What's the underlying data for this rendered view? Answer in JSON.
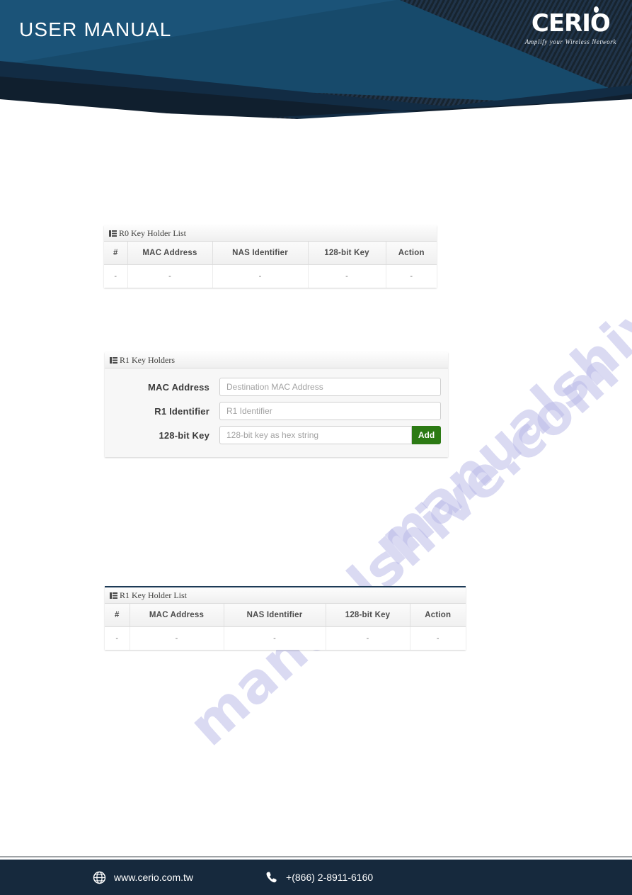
{
  "header": {
    "title": "USER MANUAL",
    "logo": {
      "name": "CERIO",
      "tagline": "Amplify your Wireless Network"
    }
  },
  "watermark": {
    "line1": "manualshive.com",
    "line2": "manualshive.com"
  },
  "panels": {
    "r0_list": {
      "heading": "R0 Key Holder List",
      "icon": "list-icon",
      "columns": [
        "#",
        "MAC Address",
        "NAS Identifier",
        "128-bit Key",
        "Action"
      ],
      "rows": [
        [
          "-",
          "-",
          "-",
          "-",
          "-"
        ]
      ]
    },
    "r1_form": {
      "heading": "R1 Key Holders",
      "icon": "list-icon",
      "fields": [
        {
          "label": "MAC Address",
          "value": "",
          "placeholder": "Destination MAC Address"
        },
        {
          "label": "R1 Identifier",
          "value": "",
          "placeholder": "R1 Identifier"
        },
        {
          "label": "128-bit Key",
          "value": "",
          "placeholder": "128-bit key as hex string"
        }
      ],
      "add_button": "Add",
      "add_button_color": "#2c7a14"
    },
    "r1_list": {
      "heading": "R1 Key Holder List",
      "icon": "list-icon",
      "columns": [
        "#",
        "MAC Address",
        "NAS Identifier",
        "128-bit Key",
        "Action"
      ],
      "rows": [
        [
          "-",
          "-",
          "-",
          "-",
          "-"
        ]
      ]
    }
  },
  "footer": {
    "website": "www.cerio.com.tw",
    "website_icon": "globe-icon",
    "phone": "+(866) 2-8911-6160",
    "phone_icon": "phone-icon",
    "background": "#16293d"
  }
}
